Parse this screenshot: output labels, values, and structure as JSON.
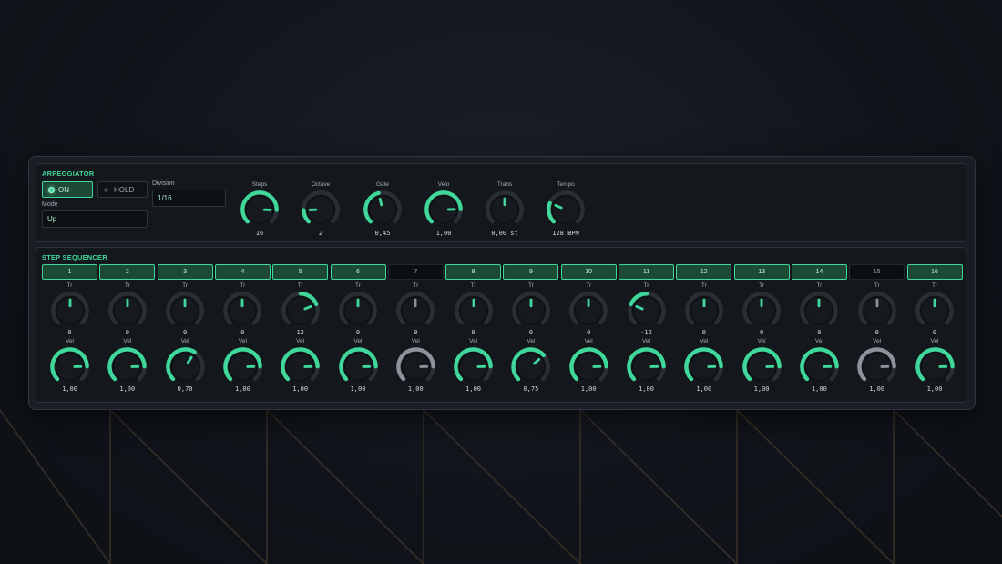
{
  "colors": {
    "accent": "#3fd79a",
    "inactive": "#8b929c",
    "track": "#2a2f36",
    "knob_face": "#161a1f"
  },
  "arp": {
    "title": "ARPEGGIATOR",
    "on_label": "ON",
    "hold_label": "HOLD",
    "mode_label": "Mode",
    "mode_value": "Up",
    "division_label": "Division",
    "division_value": "1/16",
    "knobs": [
      {
        "label": "Steps",
        "value": "16",
        "level": 0.84
      },
      {
        "label": "Octave",
        "value": "2",
        "level": 0.16
      },
      {
        "label": "Gate",
        "value": "0,45",
        "level": 0.45
      },
      {
        "label": "Velo",
        "value": "1,00",
        "level": 0.83
      },
      {
        "label": "Trans",
        "value": "0,00 st",
        "level": 0.5,
        "bipolar": true
      },
      {
        "label": "Tempo",
        "value": "128 BPM",
        "level": 0.25
      }
    ]
  },
  "seq": {
    "title": "STEP SEQUENCER",
    "tr_label": "Tr",
    "vel_label": "Vel",
    "steps": [
      {
        "num": "1",
        "active": true,
        "tr": "0",
        "tr_level": 0.5,
        "vel": "1,00",
        "vel_level": 0.83
      },
      {
        "num": "2",
        "active": true,
        "tr": "0",
        "tr_level": 0.5,
        "vel": "1,00",
        "vel_level": 0.83
      },
      {
        "num": "3",
        "active": true,
        "tr": "0",
        "tr_level": 0.5,
        "vel": "0,70",
        "vel_level": 0.62
      },
      {
        "num": "4",
        "active": true,
        "tr": "0",
        "tr_level": 0.5,
        "vel": "1,00",
        "vel_level": 0.83
      },
      {
        "num": "5",
        "active": true,
        "tr": "12",
        "tr_level": 0.75,
        "vel": "1,00",
        "vel_level": 0.83
      },
      {
        "num": "6",
        "active": true,
        "tr": "0",
        "tr_level": 0.5,
        "vel": "1,00",
        "vel_level": 0.83
      },
      {
        "num": "7",
        "active": false,
        "tr": "0",
        "tr_level": 0.5,
        "vel": "1,00",
        "vel_level": 0.83
      },
      {
        "num": "8",
        "active": true,
        "tr": "0",
        "tr_level": 0.5,
        "vel": "1,00",
        "vel_level": 0.83
      },
      {
        "num": "9",
        "active": true,
        "tr": "0",
        "tr_level": 0.5,
        "vel": "0,75",
        "vel_level": 0.68
      },
      {
        "num": "10",
        "active": true,
        "tr": "0",
        "tr_level": 0.5,
        "vel": "1,00",
        "vel_level": 0.83
      },
      {
        "num": "11",
        "active": true,
        "tr": "-12",
        "tr_level": 0.25,
        "vel": "1,00",
        "vel_level": 0.83
      },
      {
        "num": "12",
        "active": true,
        "tr": "0",
        "tr_level": 0.5,
        "vel": "1,00",
        "vel_level": 0.83
      },
      {
        "num": "13",
        "active": true,
        "tr": "0",
        "tr_level": 0.5,
        "vel": "1,00",
        "vel_level": 0.83
      },
      {
        "num": "14",
        "active": true,
        "tr": "0",
        "tr_level": 0.5,
        "vel": "1,00",
        "vel_level": 0.83
      },
      {
        "num": "15",
        "active": false,
        "tr": "0",
        "tr_level": 0.5,
        "vel": "1,00",
        "vel_level": 0.83
      },
      {
        "num": "16",
        "active": true,
        "tr": "0",
        "tr_level": 0.5,
        "vel": "1,00",
        "vel_level": 0.83
      }
    ]
  }
}
